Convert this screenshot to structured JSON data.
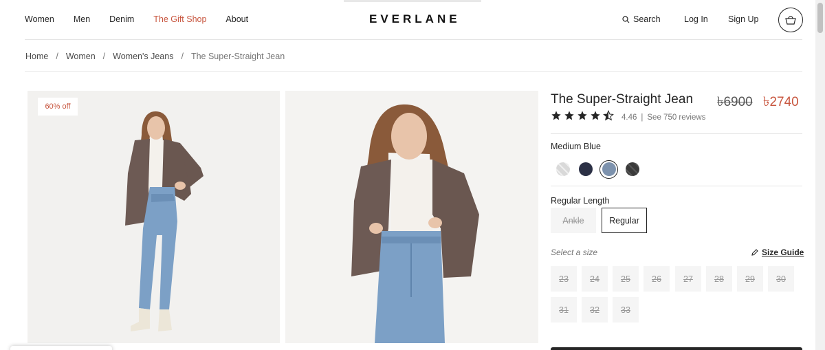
{
  "nav": {
    "links": [
      "Women",
      "Men",
      "Denim",
      "The Gift Shop",
      "About"
    ],
    "logo": "EVERLANE",
    "search": "Search",
    "login": "Log In",
    "signup": "Sign Up"
  },
  "breadcrumb": [
    "Home",
    "Women",
    "Women's Jeans",
    "The Super-Straight Jean"
  ],
  "badge": "60% off",
  "product": {
    "title": "The Super-Straight Jean",
    "price_old": "৳6900",
    "price_new": "৳2740",
    "rating": 4.46,
    "rating_text": "4.46",
    "reviews": "See 750 reviews",
    "color_label": "Medium Blue",
    "colors": [
      "#e3e3e3",
      "#2b3045",
      "#7d92ad",
      "#3a3a3a"
    ],
    "length_label": "Regular Length",
    "lengths": [
      "Ankle",
      "Regular"
    ],
    "size_label": "Select a size",
    "size_guide": "Size Guide",
    "sizes": [
      "23",
      "24",
      "25",
      "26",
      "27",
      "28",
      "29",
      "30",
      "31",
      "32",
      "33"
    ]
  },
  "colors": {
    "accent": "#c8563f",
    "text": "#262626"
  }
}
